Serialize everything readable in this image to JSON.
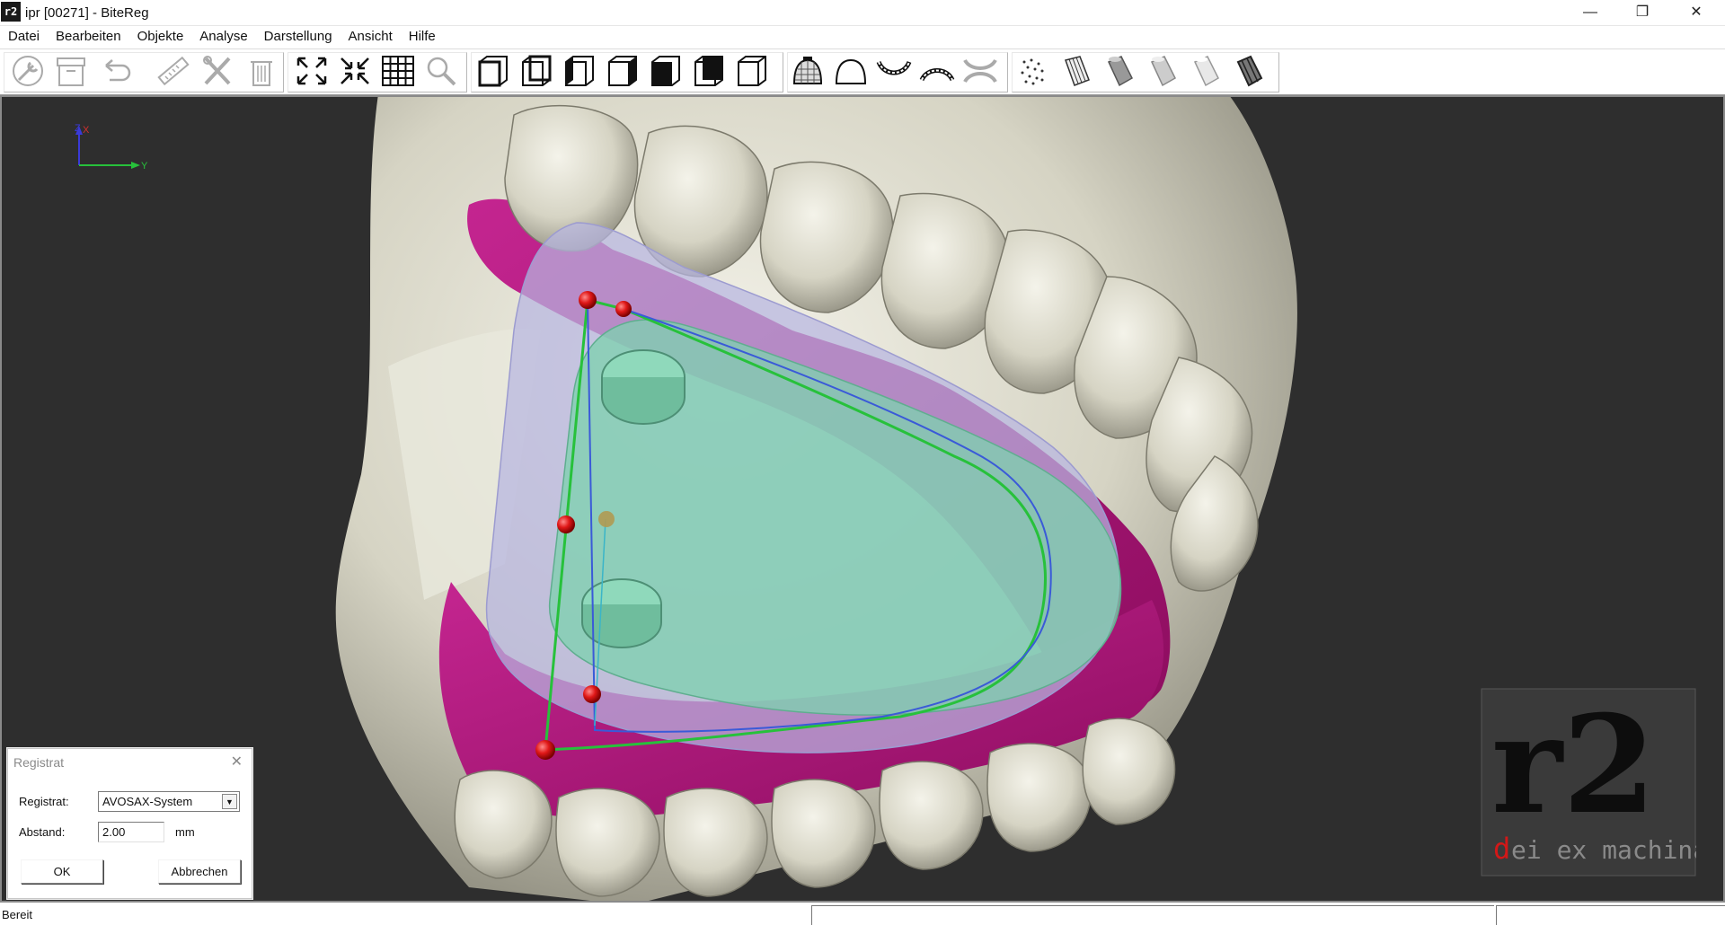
{
  "window": {
    "app_icon": "r2",
    "title": "ipr [00271] - BiteReg",
    "minimize_glyph": "—",
    "restore_glyph": "❐",
    "close_glyph": "✕"
  },
  "menu": [
    "Datei",
    "Bearbeiten",
    "Objekte",
    "Analyse",
    "Darstellung",
    "Ansicht",
    "Hilfe"
  ],
  "toolbar": {
    "icons": [
      "tools-icon",
      "archive-icon",
      "undo-icon",
      "ruler-icon",
      "crossed-tools-icon",
      "trash-icon",
      "fit-view-icon",
      "zoom-in-view-icon",
      "grid-icon",
      "magnifier-icon",
      "cube-view-1-icon",
      "cube-view-2-icon",
      "cube-view-3-icon",
      "cube-view-4-icon",
      "cube-view-5-icon",
      "cube-view-6-icon",
      "cube-view-7-icon",
      "model-dome-mesh-icon",
      "model-dome-icon",
      "upper-jaw-icon",
      "lower-jaw-icon",
      "both-jaws-icon",
      "point-cloud-icon",
      "cylinder-wire-icon",
      "cylinder-gray-icon",
      "cylinder-light-icon",
      "cylinder-white-icon",
      "cylinder-dark-icon"
    ]
  },
  "viewport": {
    "background": "#2e2e2e",
    "axis": {
      "z_label": "Z",
      "x_label": "X",
      "y_label": "Y"
    },
    "colors": {
      "tooth": "#d9d7c8",
      "gum": "#b0187a",
      "plate_outer": "#b7b6e0",
      "plate_inner": "#7fd1b0",
      "outline_green": "#27c13b",
      "outline_blue": "#3a5ad8",
      "marker_red": "#e01818"
    }
  },
  "logo": {
    "big": "r2",
    "tagline_first": "d",
    "tagline_rest": "ei ex machina"
  },
  "dialog": {
    "title": "Registrat",
    "registrat_label": "Registrat:",
    "registrat_value": "AVOSAX-System",
    "abstand_label": "Abstand:",
    "abstand_value": "2.00",
    "unit": "mm",
    "ok_label": "OK",
    "cancel_label": "Abbrechen"
  },
  "status": {
    "text": "Bereit"
  }
}
